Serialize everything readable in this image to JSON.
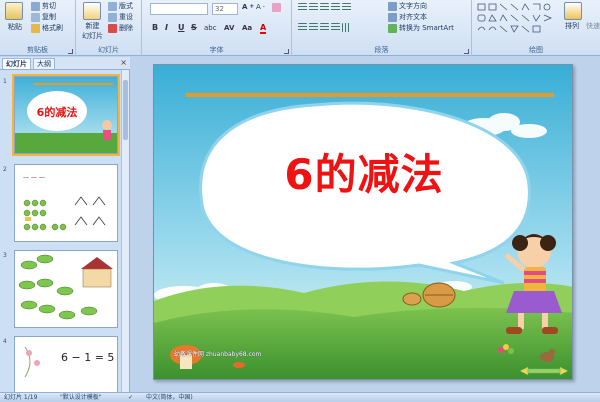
{
  "ribbon": {
    "clipboard": {
      "paste": "粘贴",
      "cut": "剪切",
      "copy": "复制",
      "format_painter": "格式刷",
      "label": "剪贴板"
    },
    "slides": {
      "new_slide_line1": "新建",
      "new_slide_line2": "幻灯片",
      "layout": "版式",
      "reset": "重设",
      "delete": "删除",
      "label": "幻灯片"
    },
    "font": {
      "font_name": "",
      "font_size": "32",
      "bold": "B",
      "italic": "I",
      "underline": "U",
      "strike": "S",
      "shadow": "abc",
      "spacing": "AV",
      "case": "Aa",
      "color": "A",
      "label": "字体"
    },
    "paragraph": {
      "text_direction": "文字方向",
      "align_text": "对齐文本",
      "smartart": "转换为 SmartArt",
      "label": "段落"
    },
    "drawing": {
      "arrange": "排列",
      "quick_styles": "快速",
      "label": "绘图"
    }
  },
  "left_panel": {
    "tabs": [
      "幻灯片",
      "大纲"
    ],
    "close": "×",
    "thumbs": [
      {
        "num": "1",
        "title": "6的减法"
      },
      {
        "num": "2",
        "title": "一 一 一"
      },
      {
        "num": "3",
        "title": ""
      },
      {
        "num": "4",
        "equation": "6 − 1 = 5"
      }
    ]
  },
  "slide": {
    "title": "6的减法",
    "website": "幼教课件网 zhuanbaby68.com"
  },
  "status": {
    "slide_info": "幻灯片 1/19",
    "theme": "\"默认设计模板\"",
    "language": "中文(简体，中国)"
  },
  "colors": {
    "title_red": "#ee1212",
    "sky_top": "#3fb0d8",
    "grass": "#4aa83a",
    "orange_bar": "#e59a2a"
  }
}
